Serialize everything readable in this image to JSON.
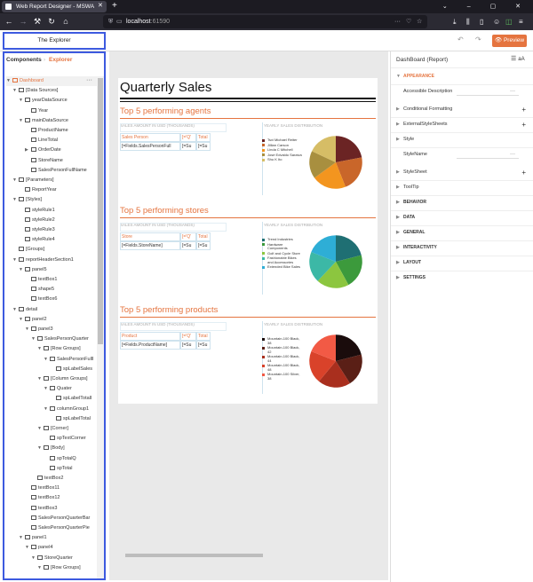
{
  "browser": {
    "tab_title": "Web Report Designer - MSWA",
    "url_host": "localhost",
    "url_port": ":61590"
  },
  "app": {
    "explorer_title": "The Explorer",
    "preview_label": "Preview",
    "colors": {
      "accent": "#e5743f",
      "highlight": "#3d5adf"
    }
  },
  "left_panel": {
    "tab_components": "Components",
    "tab_separator": "›",
    "tab_explorer": "Explorer",
    "tree": [
      {
        "label": "Dashboard",
        "indent": 0,
        "arrow": "▼",
        "selected": true
      },
      {
        "label": "[Data Sources]",
        "indent": 1,
        "arrow": "▼"
      },
      {
        "label": "yearDataSource",
        "indent": 2,
        "arrow": "▼"
      },
      {
        "label": "Year",
        "indent": 3,
        "arrow": ""
      },
      {
        "label": "mainDataSource",
        "indent": 2,
        "arrow": "▼"
      },
      {
        "label": "ProductName",
        "indent": 3,
        "arrow": ""
      },
      {
        "label": "LineTotal",
        "indent": 3,
        "arrow": ""
      },
      {
        "label": "OrderDate",
        "indent": 3,
        "arrow": "▶"
      },
      {
        "label": "StoreName",
        "indent": 3,
        "arrow": ""
      },
      {
        "label": "SalesPersonFullName",
        "indent": 3,
        "arrow": ""
      },
      {
        "label": "[Parameters]",
        "indent": 1,
        "arrow": "▼"
      },
      {
        "label": "ReportYear",
        "indent": 2,
        "arrow": ""
      },
      {
        "label": "[Styles]",
        "indent": 1,
        "arrow": "▼"
      },
      {
        "label": "styleRule1",
        "indent": 2,
        "arrow": ""
      },
      {
        "label": "styleRule2",
        "indent": 2,
        "arrow": ""
      },
      {
        "label": "styleRule3",
        "indent": 2,
        "arrow": ""
      },
      {
        "label": "styleRule4",
        "indent": 2,
        "arrow": ""
      },
      {
        "label": "[Groups]",
        "indent": 1,
        "arrow": ""
      },
      {
        "label": "reportHeaderSection1",
        "indent": 1,
        "arrow": "▼"
      },
      {
        "label": "panel5",
        "indent": 2,
        "arrow": "▼"
      },
      {
        "label": "textBox1",
        "indent": 3,
        "arrow": ""
      },
      {
        "label": "shape5",
        "indent": 3,
        "arrow": ""
      },
      {
        "label": "textBox6",
        "indent": 3,
        "arrow": ""
      },
      {
        "label": "detail",
        "indent": 1,
        "arrow": "▼"
      },
      {
        "label": "panel2",
        "indent": 2,
        "arrow": "▼"
      },
      {
        "label": "panel3",
        "indent": 3,
        "arrow": "▼"
      },
      {
        "label": "SalesPersonQuarter",
        "indent": 4,
        "arrow": "▼"
      },
      {
        "label": "[Row Groups]",
        "indent": 5,
        "arrow": "▼"
      },
      {
        "label": "SalesPersonFullI",
        "indent": 6,
        "arrow": "▼"
      },
      {
        "label": "spLabelSales",
        "indent": 7,
        "arrow": ""
      },
      {
        "label": "[Column Groups]",
        "indent": 5,
        "arrow": "▼"
      },
      {
        "label": "Quater",
        "indent": 6,
        "arrow": "▼"
      },
      {
        "label": "spLabelTotalI",
        "indent": 7,
        "arrow": ""
      },
      {
        "label": "columnGroup1",
        "indent": 6,
        "arrow": "▼"
      },
      {
        "label": "spLabelTotal",
        "indent": 7,
        "arrow": ""
      },
      {
        "label": "[Corner]",
        "indent": 5,
        "arrow": "▼"
      },
      {
        "label": "spTextCorner",
        "indent": 6,
        "arrow": ""
      },
      {
        "label": "[Body]",
        "indent": 5,
        "arrow": "▼"
      },
      {
        "label": "spTotalQ",
        "indent": 6,
        "arrow": ""
      },
      {
        "label": "spTotal",
        "indent": 6,
        "arrow": ""
      },
      {
        "label": "textBox2",
        "indent": 4,
        "arrow": ""
      },
      {
        "label": "textBox11",
        "indent": 3,
        "arrow": ""
      },
      {
        "label": "textBox12",
        "indent": 3,
        "arrow": ""
      },
      {
        "label": "textBox3",
        "indent": 3,
        "arrow": ""
      },
      {
        "label": "SalesPersonQuarterBar",
        "indent": 3,
        "arrow": ""
      },
      {
        "label": "SalesPersonQuarterPie",
        "indent": 3,
        "arrow": ""
      },
      {
        "label": "panel1",
        "indent": 2,
        "arrow": "▼"
      },
      {
        "label": "panel4",
        "indent": 3,
        "arrow": "▼"
      },
      {
        "label": "StoreQuarter",
        "indent": 4,
        "arrow": "▼"
      },
      {
        "label": "[Row Groups]",
        "indent": 5,
        "arrow": "▼"
      }
    ]
  },
  "report": {
    "title": "Quarterly Sales",
    "sections": [
      {
        "title": "Top 5 performing agents",
        "left_header": "SALES AMOUNT IN USD (THOUSANDS)",
        "right_header": "YEARLY SALES DISTRIBUTION",
        "row_label": "Sales Person",
        "col1": "[='Q'",
        "col2": "Total",
        "field": "[=Fields.SalesPersonFull",
        "cell1": "[=Su",
        "cell2": "[=Su",
        "legend": [
          {
            "label": "Tsvi Michael Reiter",
            "color": "#6b2424"
          },
          {
            "label": "Jillian Carson",
            "color": "#c9662a"
          },
          {
            "label": "Linda C Mitchell",
            "color": "#f3951f"
          },
          {
            "label": "José Edvaldo Saraiva",
            "color": "#a88f3f"
          },
          {
            "label": "Shu K Ito",
            "color": "#d6bd66"
          }
        ],
        "slices": [
          {
            "value": 22,
            "color": "#6b2424"
          },
          {
            "value": 22,
            "color": "#c9662a"
          },
          {
            "value": 21,
            "color": "#f3951f"
          },
          {
            "value": 17,
            "color": "#a88f3f"
          },
          {
            "value": 18,
            "color": "#d6bd66"
          }
        ]
      },
      {
        "title": "Top 5 performing stores",
        "left_header": "SALES AMOUNT IN USD (THOUSANDS)",
        "right_header": "YEARLY SALES DISTRIBUTION",
        "row_label": "Store",
        "col1": "[='Q'",
        "col2": "Total",
        "field": "[=Fields.StoreName]",
        "cell1": "[=Su",
        "cell2": "[=Su",
        "legend": [
          {
            "label": "Trend Industries",
            "color": "#1f6f73"
          },
          {
            "label": "Hardware Components",
            "color": "#3c9a3c"
          },
          {
            "label": "Golf and Cycle Store",
            "color": "#8cc63f"
          },
          {
            "label": "Fashionable Bikes and Accessories",
            "color": "#3cb8a6"
          },
          {
            "label": "Extended Bike Sales",
            "color": "#2eaed6"
          }
        ],
        "slices": [
          {
            "value": 21,
            "color": "#1f6f73"
          },
          {
            "value": 21,
            "color": "#3c9a3c"
          },
          {
            "value": 20,
            "color": "#8cc63f"
          },
          {
            "value": 19,
            "color": "#3cb8a6"
          },
          {
            "value": 19,
            "color": "#2eaed6"
          }
        ]
      },
      {
        "title": "Top 5 performing products",
        "left_header": "SALES AMOUNT IN USD (THOUSANDS)",
        "right_header": "YEARLY SALES DISTRIBUTION",
        "row_label": "Product",
        "col1": "[='Q'",
        "col2": "Total",
        "field": "[=Fields.ProductName]",
        "cell1": "[=Su",
        "cell2": "[=Su",
        "legend": [
          {
            "label": "Mountain-100 Black, 38",
            "color": "#1a0c0c"
          },
          {
            "label": "Mountain-100 Black, 42",
            "color": "#5a1f16"
          },
          {
            "label": "Mountain-100 Black, 44",
            "color": "#a92f1e"
          },
          {
            "label": "Mountain-100 Black, 48",
            "color": "#d9422a"
          },
          {
            "label": "Mountain-100 Silver, 38",
            "color": "#f25a45"
          }
        ],
        "slices": [
          {
            "value": 21,
            "color": "#1a0c0c"
          },
          {
            "value": 20,
            "color": "#5a1f16"
          },
          {
            "value": 20,
            "color": "#a92f1e"
          },
          {
            "value": 20,
            "color": "#d9422a"
          },
          {
            "value": 19,
            "color": "#f25a45"
          }
        ]
      }
    ]
  },
  "properties": {
    "header": "DashBoard (Report)",
    "items": [
      {
        "label": "APPEARANCE",
        "kind": "cat-or",
        "arrow": "▼"
      },
      {
        "label": "Accessible Description",
        "kind": "field",
        "arrow": ""
      },
      {
        "label": "Conditional Formatting",
        "kind": "plus",
        "arrow": "▶"
      },
      {
        "label": "ExternalStyleSheets",
        "kind": "plus",
        "arrow": "▶"
      },
      {
        "label": "Style",
        "kind": "row",
        "arrow": "▶"
      },
      {
        "label": "StyleName",
        "kind": "field",
        "arrow": ""
      },
      {
        "label": "StyleSheet",
        "kind": "plus",
        "arrow": "▶"
      },
      {
        "label": "ToolTip",
        "kind": "row",
        "arrow": "▶"
      },
      {
        "label": "BEHAVIOR",
        "kind": "cat",
        "arrow": "▶"
      },
      {
        "label": "DATA",
        "kind": "cat",
        "arrow": "▶"
      },
      {
        "label": "GENERAL",
        "kind": "cat",
        "arrow": "▶"
      },
      {
        "label": "INTERACTIVITY",
        "kind": "cat",
        "arrow": "▶"
      },
      {
        "label": "LAYOUT",
        "kind": "cat",
        "arrow": "▶"
      },
      {
        "label": "SETTINGS",
        "kind": "cat",
        "arrow": "▶"
      }
    ],
    "field_value": "···"
  }
}
